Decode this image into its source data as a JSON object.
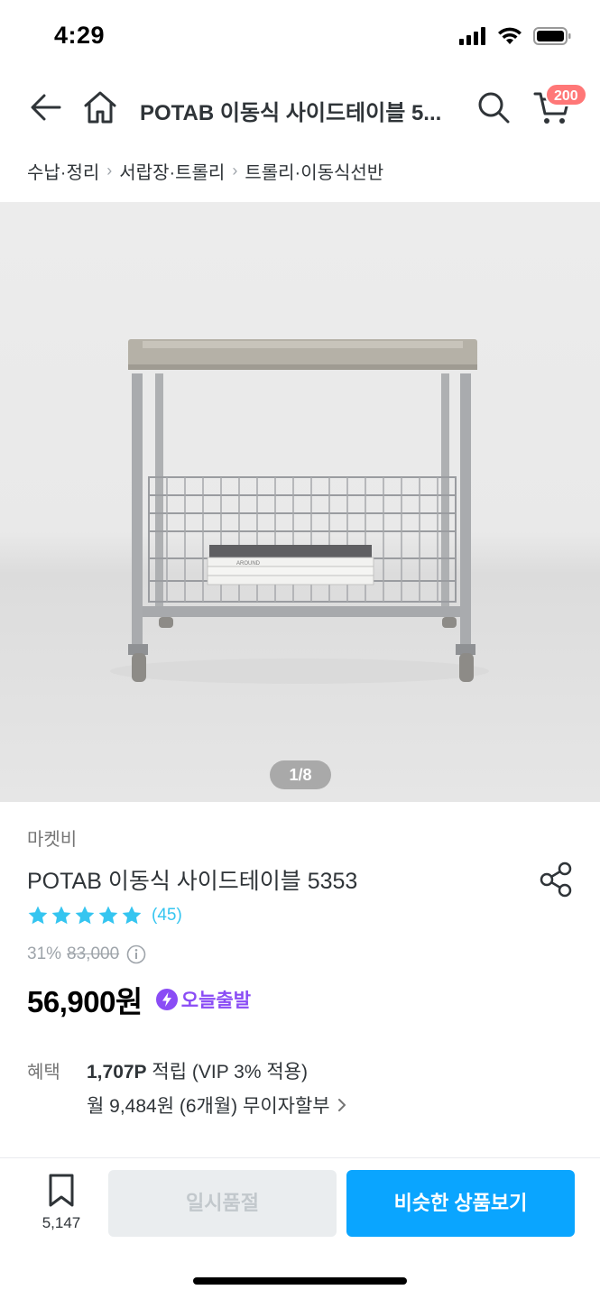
{
  "status_bar": {
    "time": "4:29"
  },
  "header": {
    "title": "POTAB 이동식 사이드테이블 5...",
    "cart_count": "200"
  },
  "breadcrumb": [
    "수납·정리",
    "서랍장·트롤리",
    "트롤리·이동식선반"
  ],
  "image": {
    "counter": "1/8",
    "book_label": "AROUND"
  },
  "product": {
    "brand": "마켓비",
    "name": "POTAB 이동식 사이드테이블 5353",
    "rating_stars": 5,
    "review_count": "(45)",
    "discount": "31%",
    "original_price": "83,000",
    "price": "56,900원",
    "delivery_badge": "오늘출발"
  },
  "benefits": {
    "label": "혜택",
    "points_bold": "1,707P",
    "points_rest": " 적립 (VIP 3% 적용)",
    "installment": "월 9,484원 (6개월) 무이자할부"
  },
  "bottom_bar": {
    "bookmark_count": "5,147",
    "soldout_label": "일시품절",
    "similar_label": "비슷한 상품보기"
  },
  "colors": {
    "accent": "#0aa5ff",
    "star": "#35c5f0",
    "badge": "#ff7777",
    "delivery": "#8a4cf5"
  }
}
